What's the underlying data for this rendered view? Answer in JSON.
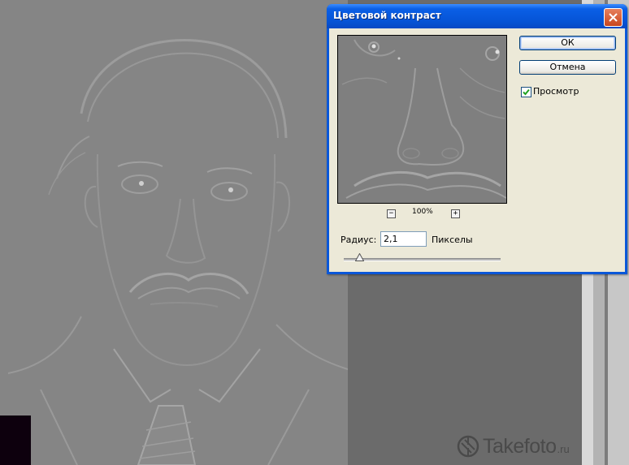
{
  "dialog": {
    "title": "Цветовой контраст",
    "close_icon": "close-icon",
    "ok_label": "ОК",
    "cancel_label": "Отмена",
    "preview_label": "Просмотр",
    "preview_checked": true,
    "zoom_level": "100%",
    "zoom_out_icon": "minus-icon",
    "zoom_in_icon": "plus-icon",
    "zoom_out_glyph": "−",
    "zoom_in_glyph": "+",
    "radius_label": "Радиус:",
    "radius_value": "2,1",
    "radius_unit": "Пикселы",
    "slider_fraction": 0.1
  },
  "watermark": {
    "text": "Takefoto",
    "suffix": ".ru"
  },
  "colors": {
    "title_bar": "#0654d6",
    "dialog_face": "#ece9d8",
    "canvas_gray": "#858585"
  }
}
